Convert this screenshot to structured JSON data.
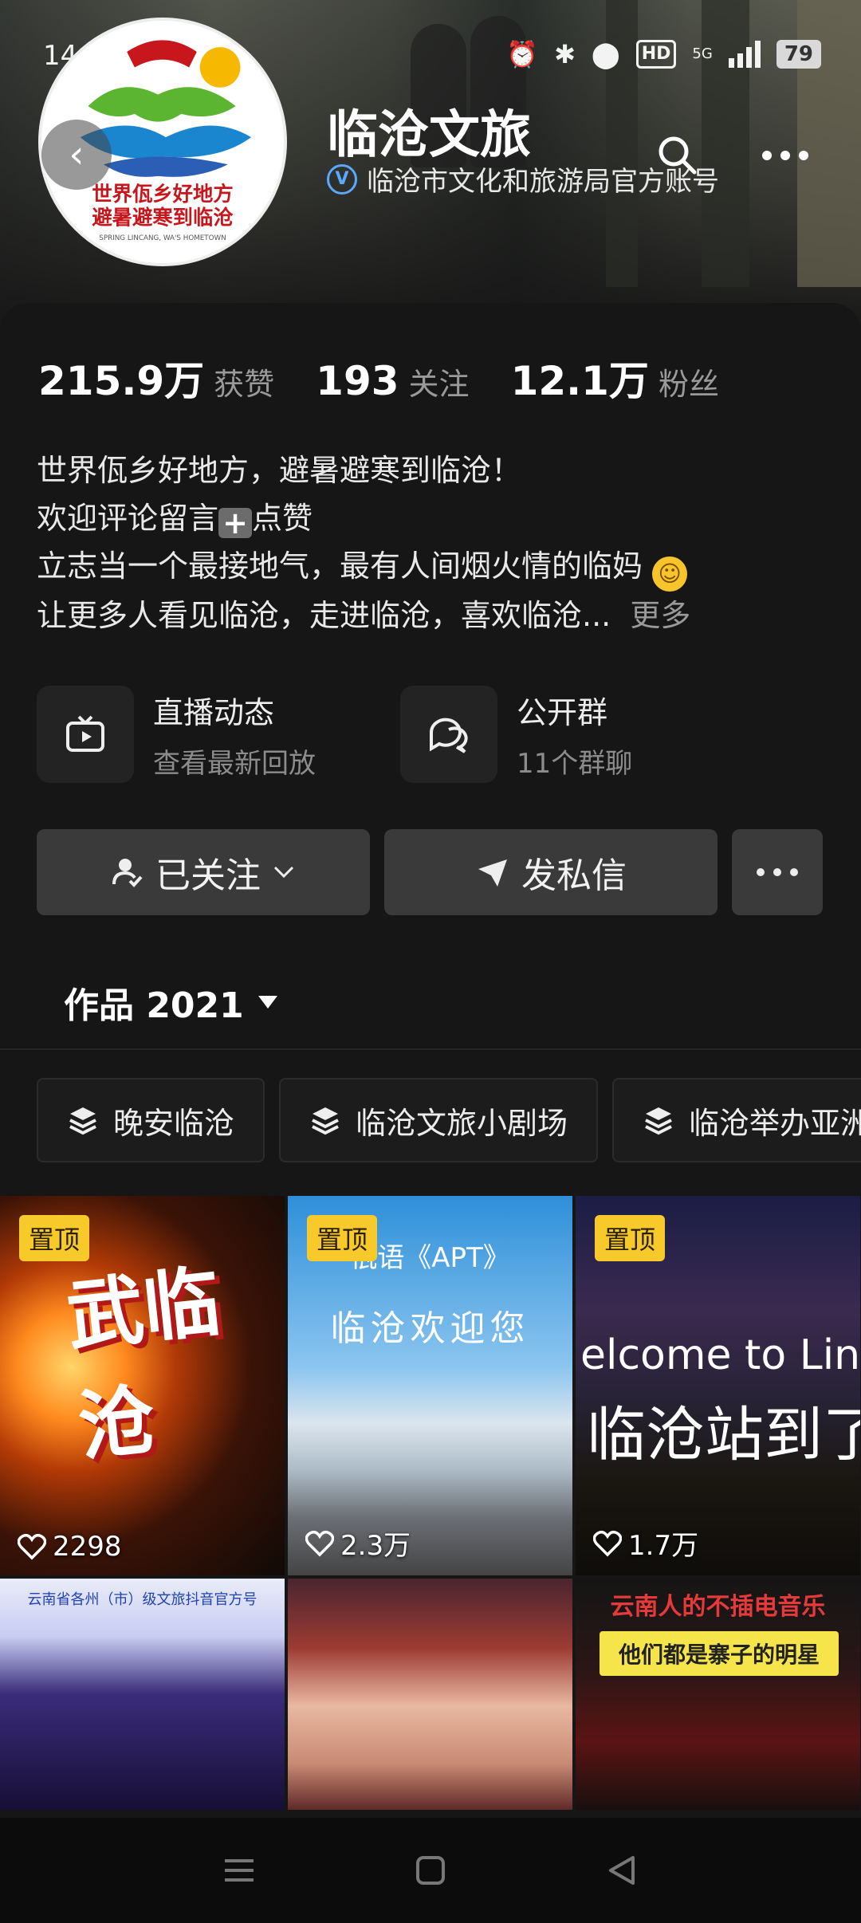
{
  "status": {
    "time": "14:49",
    "network": "5G",
    "hd": "HD",
    "battery": "79"
  },
  "profile": {
    "name": "临沧文旅",
    "verified_label": "临沧市文化和旅游局官方账号",
    "avatar_text_main": "世界佤乡好地方",
    "avatar_text_sub": "避暑避寒到临沧",
    "avatar_text_en": "SPRING LINCANG, WA'S HOMETOWN"
  },
  "stats": {
    "likes_num": "215.9万",
    "likes_label": "获赞",
    "following_num": "193",
    "following_label": "关注",
    "followers_num": "12.1万",
    "followers_label": "粉丝"
  },
  "bio": {
    "line1": "世界佤乡好地方，避暑避寒到临沧！",
    "line2_a": "欢迎评论留言",
    "line2_b": "点赞",
    "line3": "立志当一个最接地气，最有人间烟火情的临妈",
    "line4": "让更多人看见临沧，走进临沧，喜欢临沧...",
    "more": "更多"
  },
  "quick_entries": {
    "live_title": "直播动态",
    "live_sub": "查看最新回放",
    "group_title": "公开群",
    "group_sub": "11个群聊"
  },
  "actions": {
    "follow": "已关注",
    "message": "发私信"
  },
  "works_tab": "作品 2021",
  "collections": [
    "晚安临沧",
    "临沧文旅小剧场",
    "临沧举办亚洲"
  ],
  "videos": [
    {
      "pin": "置顶",
      "likes": "2298",
      "title": "武临沧"
    },
    {
      "pin": "置顶",
      "likes": "2.3万",
      "title1": "佤语《APT》",
      "title2": "临沧欢迎您"
    },
    {
      "pin": "置顶",
      "likes": "1.7万",
      "title1": "elcome to Linca",
      "title2": "临沧站到了"
    },
    {
      "title": "云南省各州（市）级文旅抖音官方号"
    },
    {},
    {
      "title": "云南人的不插电音乐",
      "sub": "他们都是寨子的明星"
    }
  ],
  "icons": {
    "back": "back-arrow-icon",
    "search": "search-icon",
    "more": "more-dots-icon",
    "tv": "tv-icon",
    "chat": "chat-bubbles-icon",
    "heart": "heart-icon"
  },
  "colors": {
    "accent_pin": "#f8c92a",
    "background": "#161616",
    "button": "#3a3a3a",
    "verify": "#5aa9ff"
  }
}
